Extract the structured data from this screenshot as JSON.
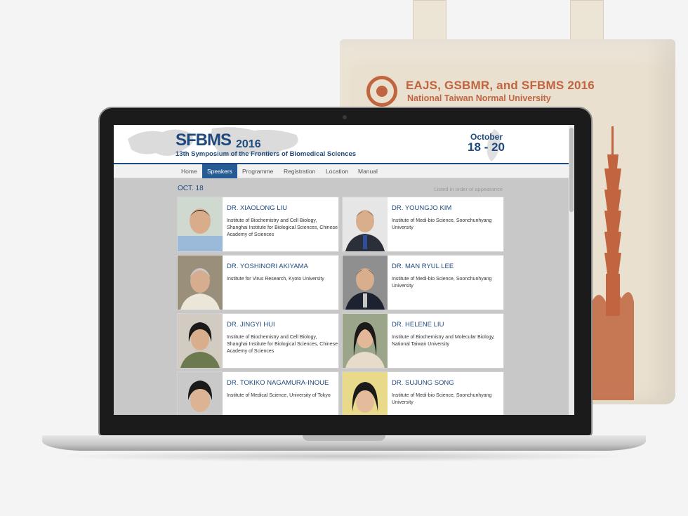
{
  "tote": {
    "title": "EAJS, GSBMR, and SFBMS 2016",
    "subtitle": "National Taiwan Normal University"
  },
  "site": {
    "logo": "SFBMS",
    "logo_year": "2016",
    "tagline": "13th Symposium of the Frontiers of Biomedical Sciences",
    "date_month": "October",
    "date_days": "18 - 20"
  },
  "nav": {
    "items": [
      {
        "label": "Home",
        "active": false
      },
      {
        "label": "Speakers",
        "active": true
      },
      {
        "label": "Programme",
        "active": false
      },
      {
        "label": "Registration",
        "active": false
      },
      {
        "label": "Location",
        "active": false
      },
      {
        "label": "Manual",
        "active": false
      }
    ]
  },
  "speakers_page": {
    "day_label": "OCT. 18",
    "order_note": "Listed in order of appearance",
    "speakers": [
      {
        "name": "DR. XIAOLONG LIU",
        "affiliation": "Institute of Biochemistry and Cell Biology, Shanghai Institute for Biological Sciences, Chinese Academy of Sciences"
      },
      {
        "name": "DR. YOUNGJO KIM",
        "affiliation": "Institute of Medi-bio Science, Soonchunhyang University"
      },
      {
        "name": "DR. YOSHINORI AKIYAMA",
        "affiliation": "Institute for Virus Research, Kyoto University"
      },
      {
        "name": "DR. MAN RYUL LEE",
        "affiliation": "Institute of Medi-bio Science, Soonchunhyang University"
      },
      {
        "name": "DR. JINGYI HUI",
        "affiliation": "Institute of Biochemistry and Cell Biology, Shanghai Institute for Biological Sciences, Chinese Academy of Sciences"
      },
      {
        "name": "DR. HELENE LIU",
        "affiliation": "Institute of Biochemistry and Molecular Biology, National Taiwan University"
      },
      {
        "name": "DR. TOKIKO NAGAMURA-INOUE",
        "affiliation": "Institute of Medical Science, University of Tokyo"
      },
      {
        "name": "DR. SUJUNG SONG",
        "affiliation": "Institute of Medi-bio Science, Soonchunhyang University"
      }
    ]
  },
  "colors": {
    "accent": "#1f4a7d",
    "nav_active": "#275b94",
    "tote_print": "#c0653f"
  }
}
